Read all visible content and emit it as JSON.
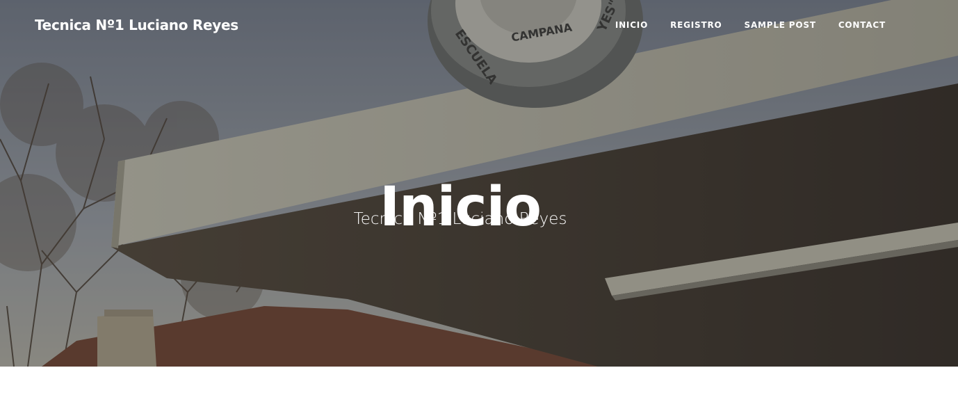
{
  "navbar": {
    "brand": "Tecnica Nº1 Luciano Reyes",
    "links": [
      "INICIO",
      "REGISTRO",
      "SAMPLE POST",
      "CONTACT"
    ]
  },
  "hero": {
    "title": "Inicio",
    "subtitle": "Tecnica Nº1 Luciano Reyes",
    "sign_text_top": "ESCUELA",
    "sign_text_city": "CAMPANA",
    "sign_text_right": "YES\""
  },
  "colors": {
    "overlay": "#1e1e1e",
    "text": "#ffffff",
    "sky": "#8a93a3",
    "canopy": "#c9c6b8",
    "roof": "#7a4a38"
  }
}
